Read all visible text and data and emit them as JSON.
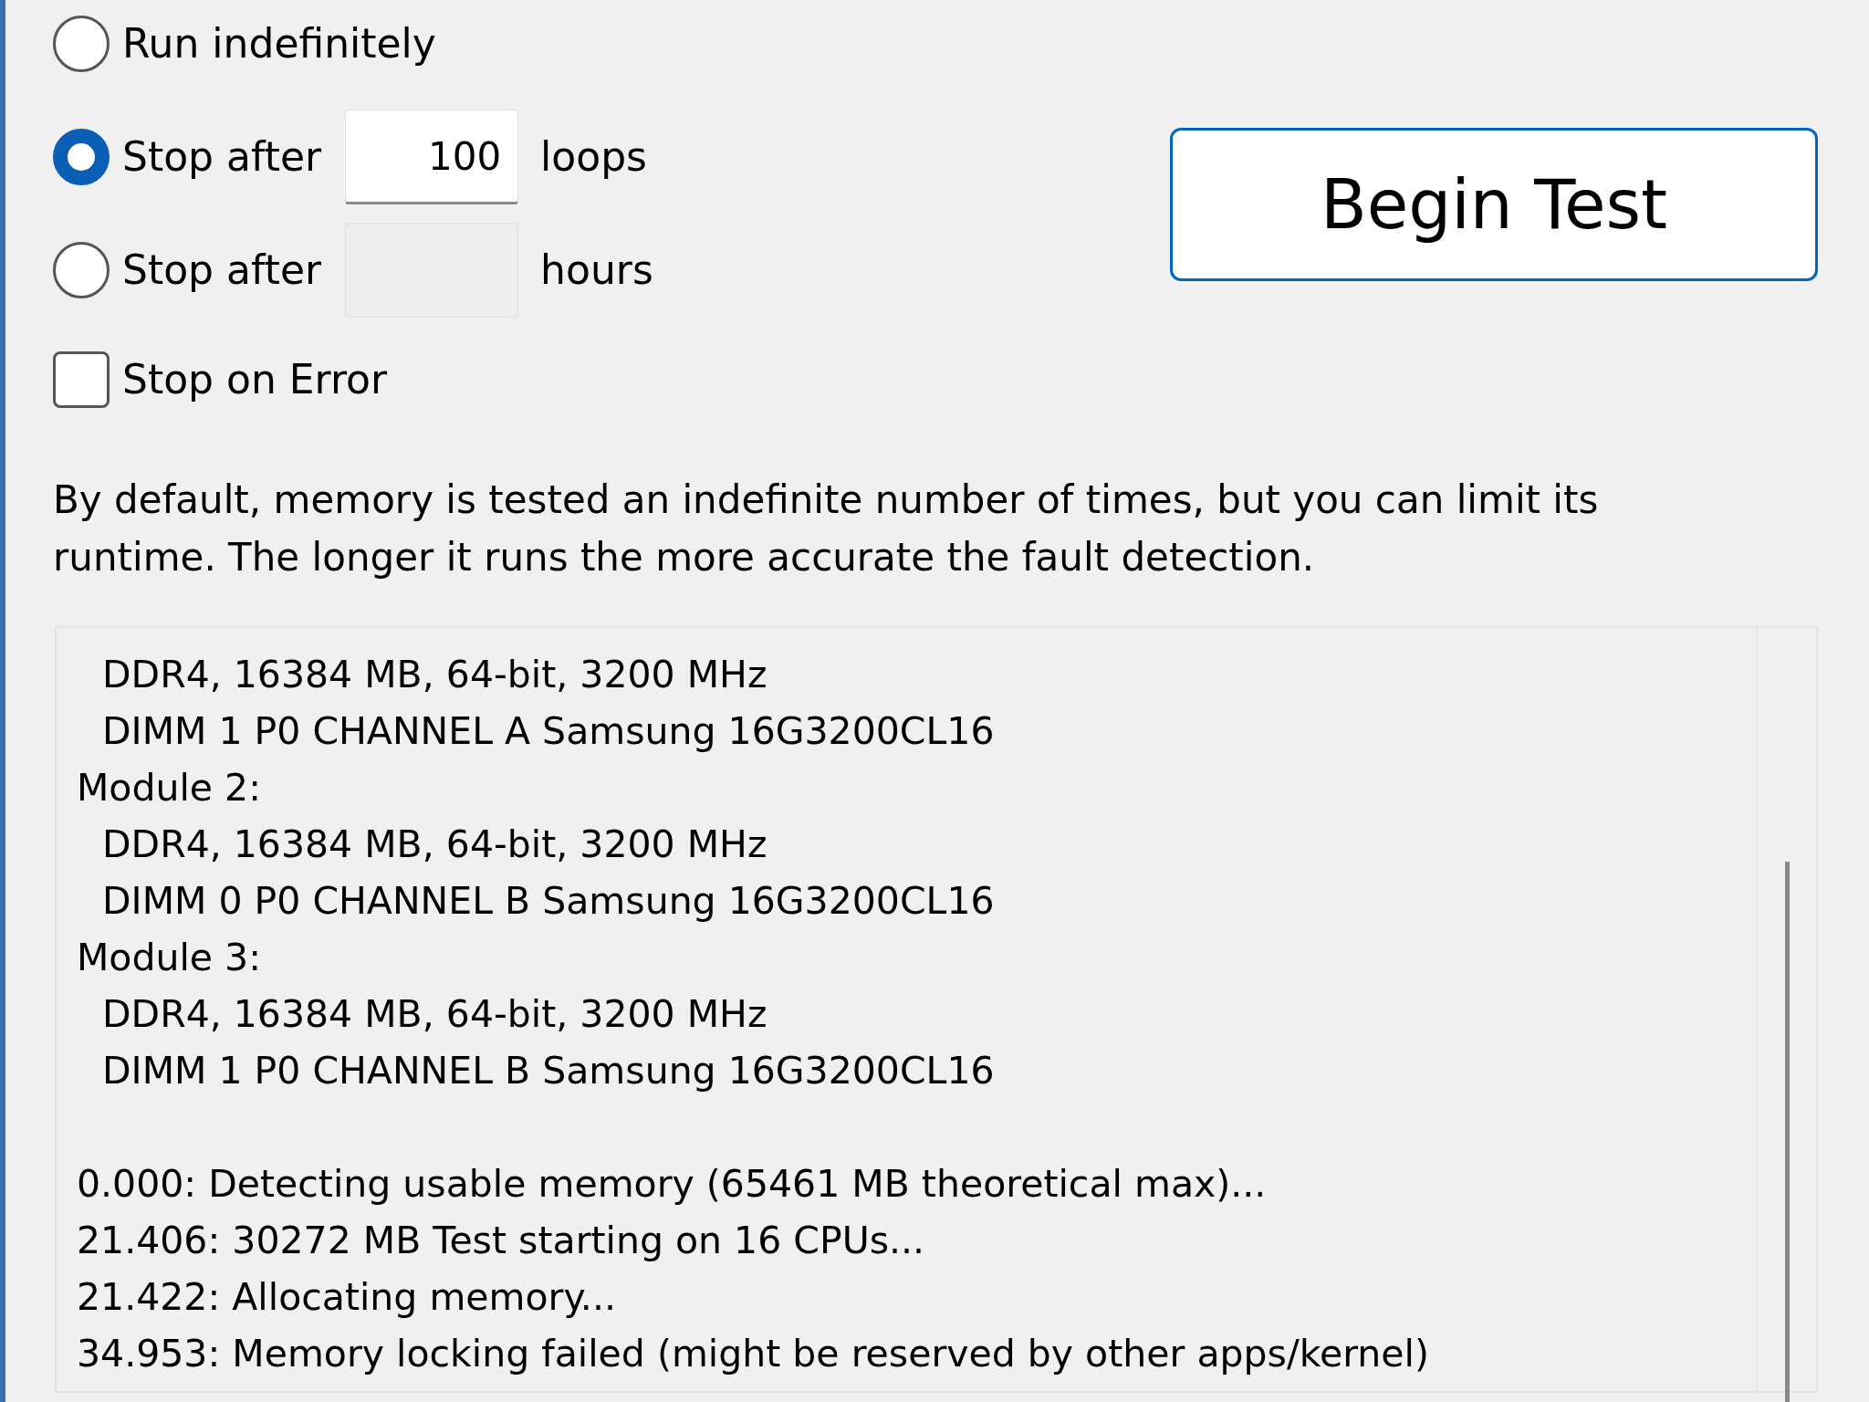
{
  "run_options": [
    {
      "kind": "plain",
      "label": "Run indefinitely",
      "selected": false
    },
    {
      "kind": "count",
      "label": "Stop after",
      "selected": true,
      "value": "100",
      "unit": "loops",
      "disabled": false
    },
    {
      "kind": "count",
      "label": "Stop after",
      "selected": false,
      "unit": "hours",
      "disabled": true
    }
  ],
  "stop_on_error": {
    "label": "Stop on Error",
    "checked": false
  },
  "begin_button": "Begin Test",
  "description": "By default, memory is tested an indefinite number of times, but you can limit its runtime. The longer it runs the more accurate the fault detection.",
  "log": [
    {
      "kind": "detail",
      "text": "DDR4, 16384 MB, 64-bit, 3200 MHz"
    },
    {
      "kind": "detail",
      "text": "DIMM 1 P0 CHANNEL A Samsung 16G3200CL16"
    },
    {
      "kind": "heading",
      "text": "Module 2:"
    },
    {
      "kind": "detail",
      "text": "DDR4, 16384 MB, 64-bit, 3200 MHz"
    },
    {
      "kind": "detail",
      "text": "DIMM 0 P0 CHANNEL B Samsung 16G3200CL16"
    },
    {
      "kind": "heading",
      "text": "Module 3:"
    },
    {
      "kind": "detail",
      "text": "DDR4, 16384 MB, 64-bit, 3200 MHz"
    },
    {
      "kind": "detail",
      "text": "DIMM 1 P0 CHANNEL B Samsung 16G3200CL16"
    },
    {
      "kind": "event",
      "text": "0.000: Detecting usable memory (65461 MB theoretical max)..."
    },
    {
      "kind": "event",
      "text": "21.406: 30272 MB Test starting on 16 CPUs..."
    },
    {
      "kind": "event",
      "text": "21.422: Allocating memory..."
    },
    {
      "kind": "event",
      "text": "34.953: Memory locking failed (might be reserved by other apps/kernel)"
    }
  ]
}
